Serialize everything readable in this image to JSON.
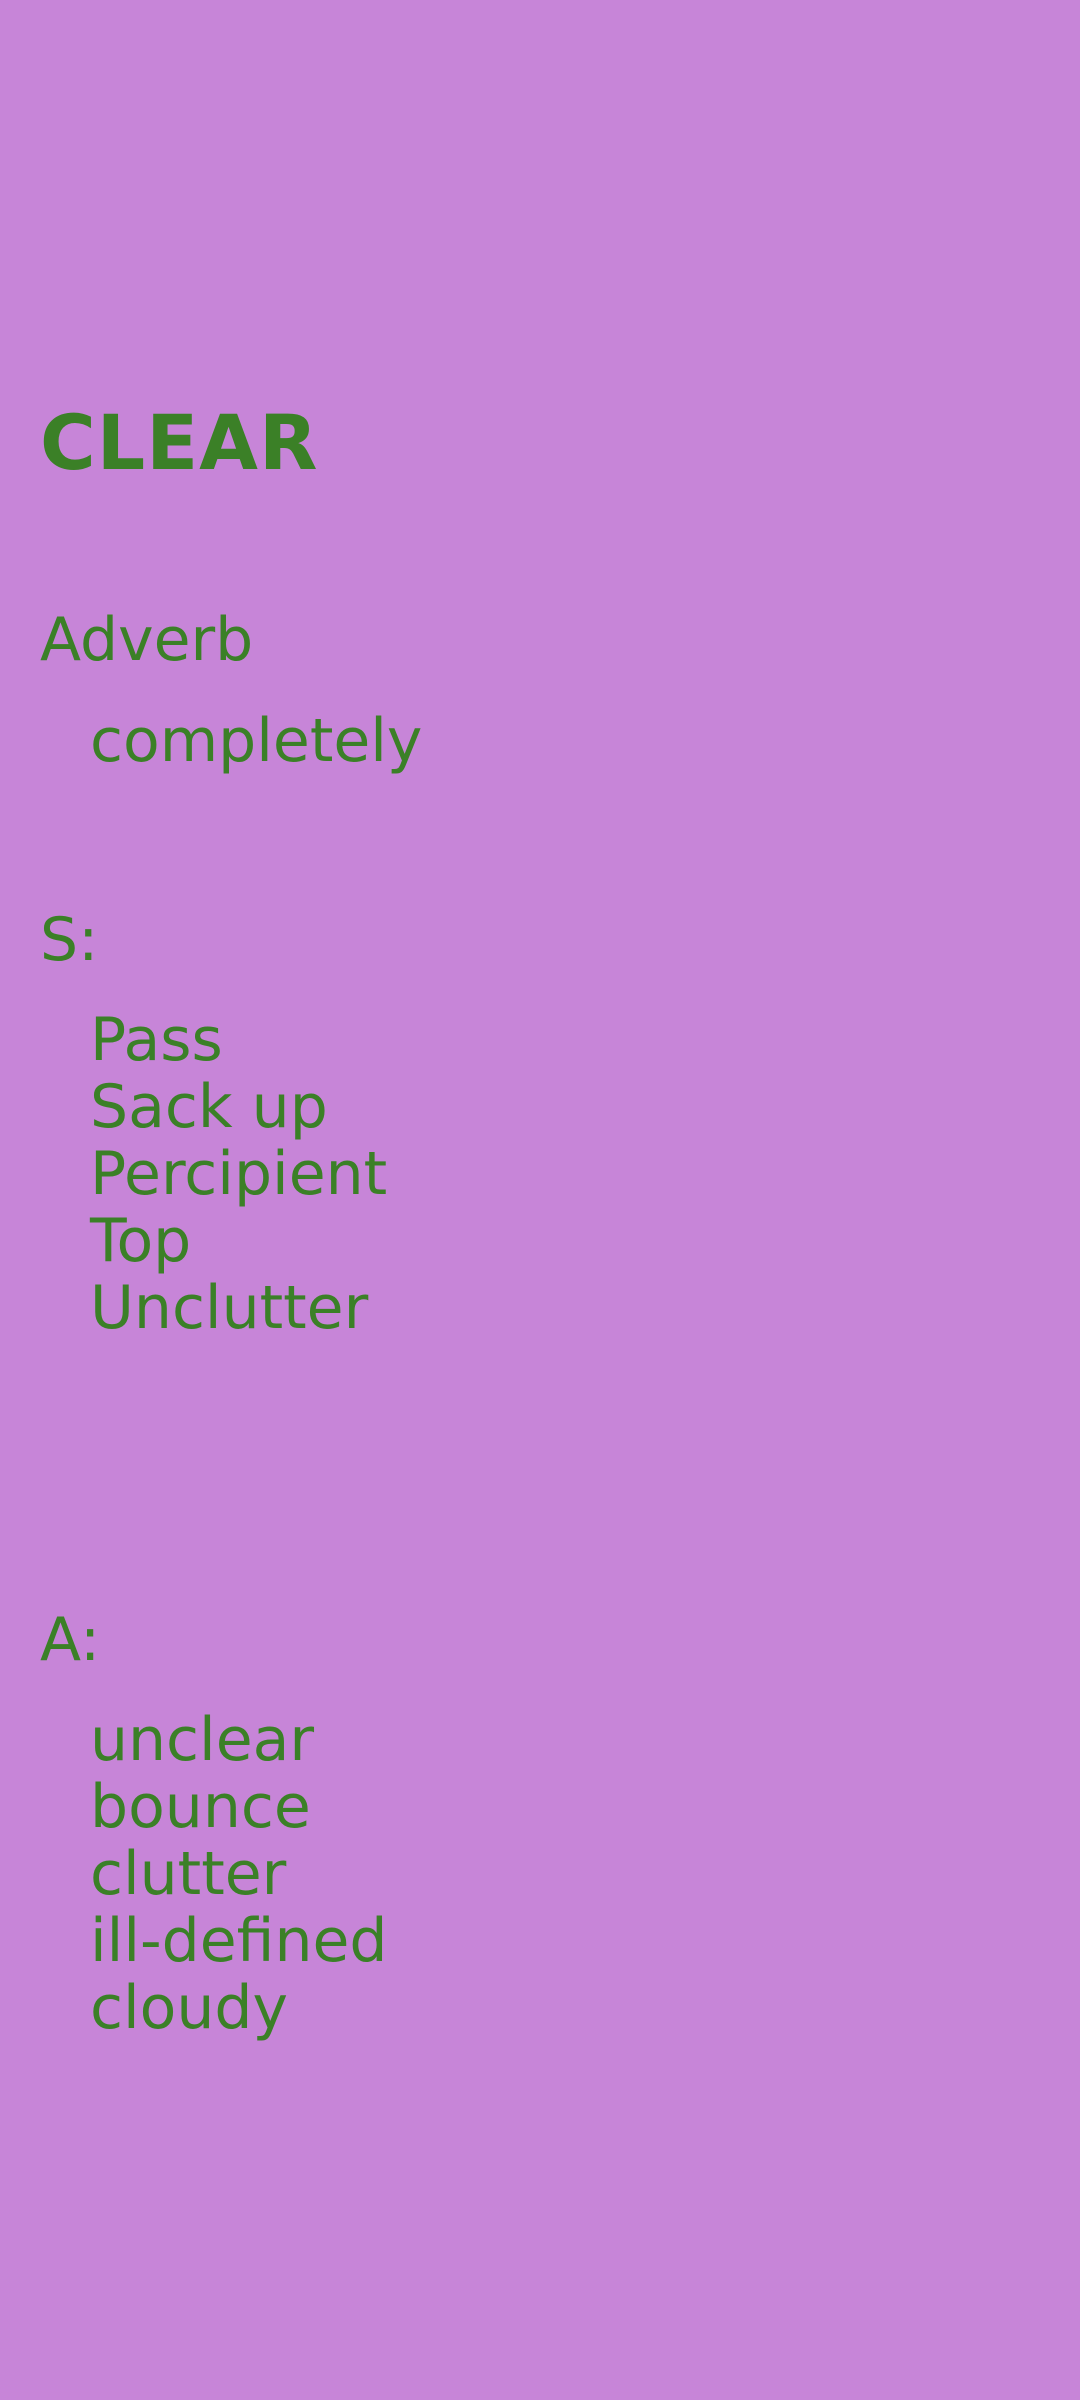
{
  "word": "CLEAR",
  "part_of_speech": "Adverb",
  "definitions": [
    "completely"
  ],
  "synonyms_label": "S:",
  "synonyms": [
    "Pass",
    "Sack up",
    "Percipient",
    "Top",
    "Unclutter"
  ],
  "antonyms_label": "A:",
  "antonyms": [
    "unclear",
    "bounce",
    "clutter",
    "ill-defined",
    "cloudy"
  ],
  "colors": {
    "background": "#c785d8",
    "text": "#3b8027"
  }
}
